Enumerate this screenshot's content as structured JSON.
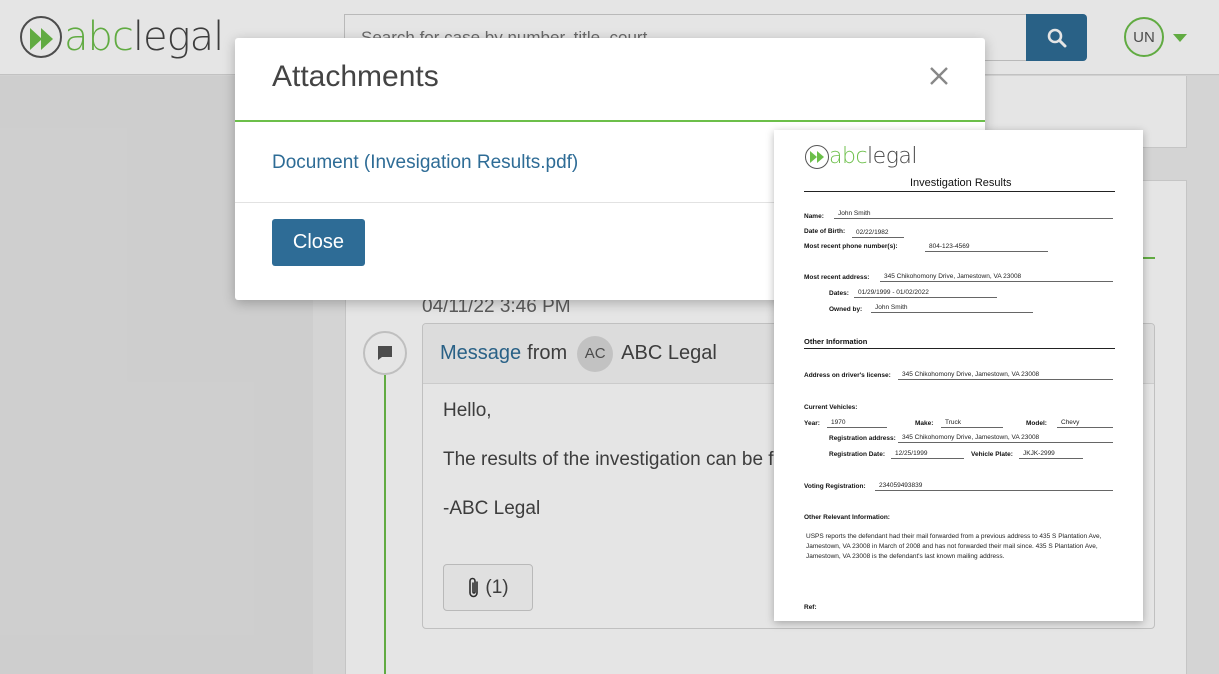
{
  "brand": {
    "logo_abc": "abc",
    "logo_legal": "legal"
  },
  "header": {
    "search_placeholder": "Search for case by number, title, court",
    "user_initials": "UN"
  },
  "message": {
    "date": "04/11/22 3:46 PM",
    "link_label": "Message",
    "from_label": "from",
    "sender_initials": "AC",
    "sender_name": "ABC Legal",
    "body": [
      "Hello,",
      "The results of the investigation can be fo",
      "-ABC Legal"
    ],
    "attachment_count": "(1)"
  },
  "modal": {
    "title": "Attachments",
    "document_link": "Document (Invesigation Results.pdf)",
    "close_button": "Close"
  },
  "preview": {
    "title": "Investigation Results",
    "labels": {
      "name": "Name:",
      "dob": "Date of Birth:",
      "phone": "Most recent phone number(s):",
      "address": "Most recent address:",
      "dates": "Dates:",
      "owned_by": "Owned by:",
      "other_info": "Other Information",
      "dl_address": "Address on driver's license:",
      "current_vehicles": "Current Vehicles:",
      "year": "Year:",
      "make": "Make:",
      "model": "Model:",
      "reg_address": "Registration address:",
      "reg_date": "Registration Date:",
      "vehicle_plate": "Vehicle Plate:",
      "voting_reg": "Voting Registration:",
      "other_relevant": "Other Relevant Information:",
      "ref": "Ref:"
    },
    "values": {
      "name": "John Smith",
      "dob": "02/22/1982",
      "phone": "804-123-4569",
      "address": "345 Chikohomony Drive, Jamestown, VA 23008",
      "dates": "01/29/1999 - 01/02/2022",
      "owned_by": "John Smith",
      "dl_address": "345 Chikohomony Drive, Jamestown, VA 23008",
      "year": "1970",
      "make": "Truck",
      "model": "Chevy",
      "reg_address": "345 Chikohomony Drive, Jamestown, VA 23008",
      "reg_date": "12/25/1999",
      "vehicle_plate": "JKJK-2999",
      "voting_reg": "234059493839",
      "other_relevant": "USPS reports the defendant had their mail forwarded from a previous address to 435 S Plantation Ave, Jamestown, VA 23008 in March of 2008 and has not forwarded their mail since. 435 S Plantation Ave, Jamestown, VA 23008 is the defendant's last known mailing address."
    }
  },
  "colors": {
    "accent_green": "#6cbf4a",
    "primary_blue": "#2e6c96"
  },
  "icons": [
    "search-icon",
    "chevron-down-icon",
    "comment-icon",
    "paperclip-icon",
    "close-icon"
  ]
}
